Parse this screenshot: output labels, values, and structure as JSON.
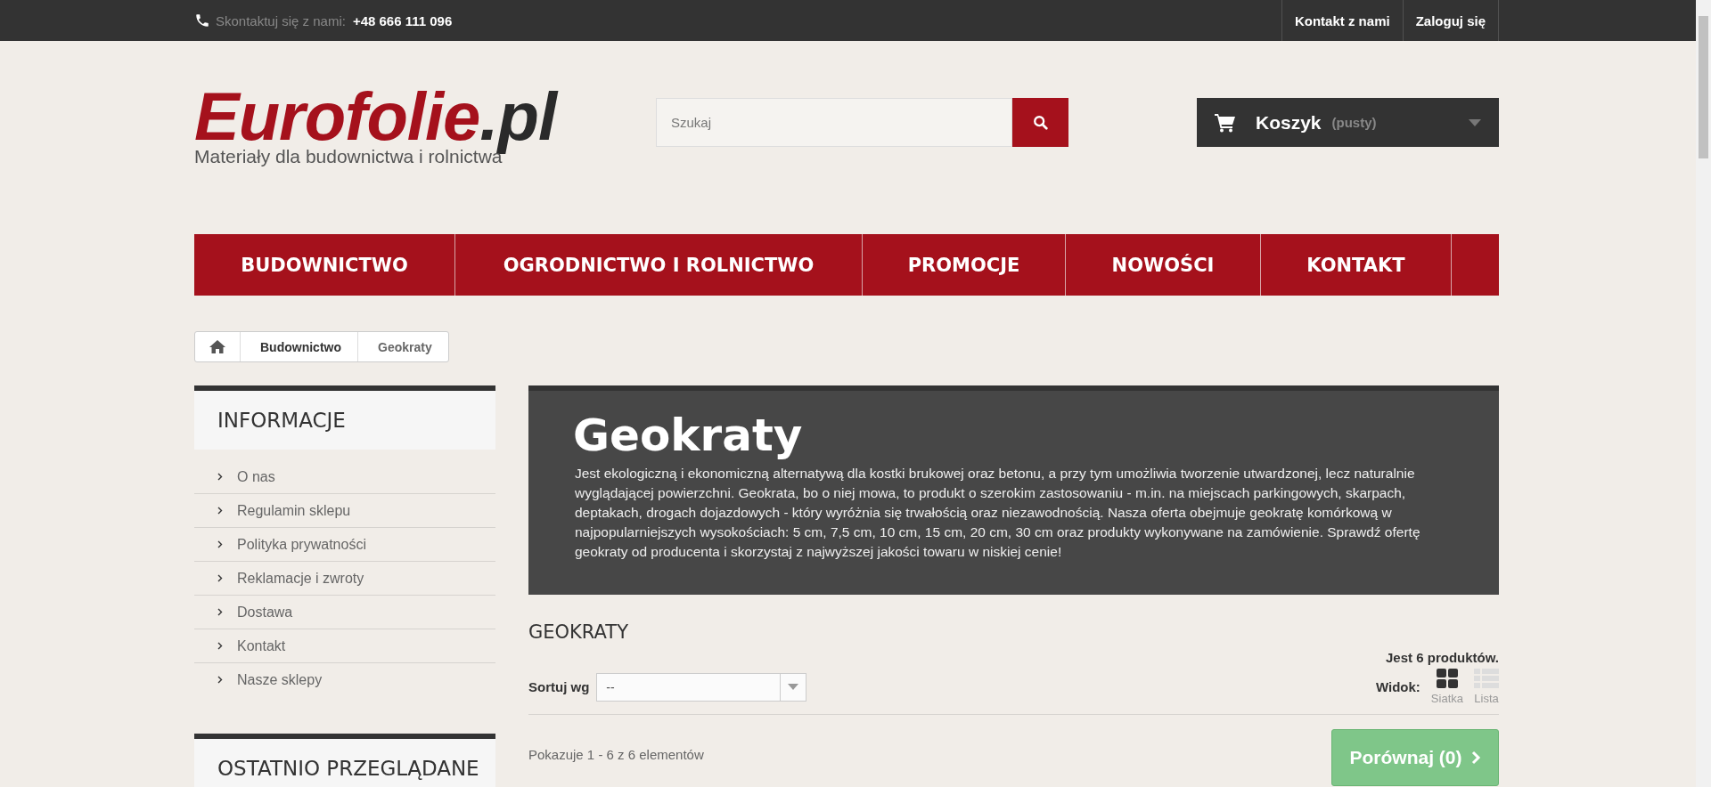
{
  "top_bar": {
    "contact_label": "Skontaktuj się z nami:",
    "phone": "+48 666 111 096",
    "links": [
      "Kontakt z nami",
      "Zaloguj się"
    ]
  },
  "header": {
    "logo": {
      "name": "Eurofolie",
      "suffix": ".pl",
      "tagline": "Materiały dla budownictwa i rolnictwa"
    },
    "search": {
      "placeholder": "Szukaj"
    },
    "cart": {
      "label": "Koszyk",
      "status": "(pusty)"
    }
  },
  "nav": [
    "BUDOWNICTWO",
    "OGRODNICTWO I ROLNICTWO",
    "PROMOCJE",
    "NOWOŚCI",
    "KONTAKT"
  ],
  "breadcrumb": [
    "Budownictwo",
    "Geokraty"
  ],
  "sidebar": {
    "blocks": [
      {
        "title": "INFORMACJE",
        "items": [
          "O nas",
          "Regulamin sklepu",
          "Polityka prywatności",
          "Reklamacje i zwroty",
          "Dostawa",
          "Kontakt",
          "Nasze sklepy"
        ]
      },
      {
        "title": "OSTATNIO PRZEGLĄDANE"
      }
    ]
  },
  "category": {
    "title": "Geokraty",
    "description": "Jest ekologiczną i ekonomiczną alternatywą dla kostki brukowej oraz betonu, a przy tym umożliwia tworzenie utwardzonej, lecz naturalnie wyglądającej powierzchni. Geokrata, bo o niej mowa, to produkt o szerokim zastosowaniu - m.in. na miejscach parkingowych, skarpach, deptakach, drogach dojazdowych - który wyróżnia się trwałością oraz niezawodnością. Nasza oferta obejmuje geokratę komórkową w najpopularniejszych wysokościach: 5 cm, 7,5 cm, 10 cm, 15 cm, 20 cm, 30 cm oraz produkty wykonywane na zamówienie. Sprawdź ofertę geokraty od producenta i skorzystaj z najwyższej jakości towaru w niskiej cenie!"
  },
  "listing": {
    "heading": "GEOKRATY",
    "count": "Jest 6 produktów.",
    "sort": {
      "label": "Sortuj wg",
      "value": "--"
    },
    "view": {
      "label": "Widok:",
      "options": [
        {
          "kind": "grid",
          "label": "Siatka",
          "selected": true
        },
        {
          "kind": "list",
          "label": "Lista",
          "selected": false
        }
      ]
    },
    "showing": "Pokazuje 1 - 6 z 6 elementów",
    "compare_button": "Porównaj (0)"
  }
}
